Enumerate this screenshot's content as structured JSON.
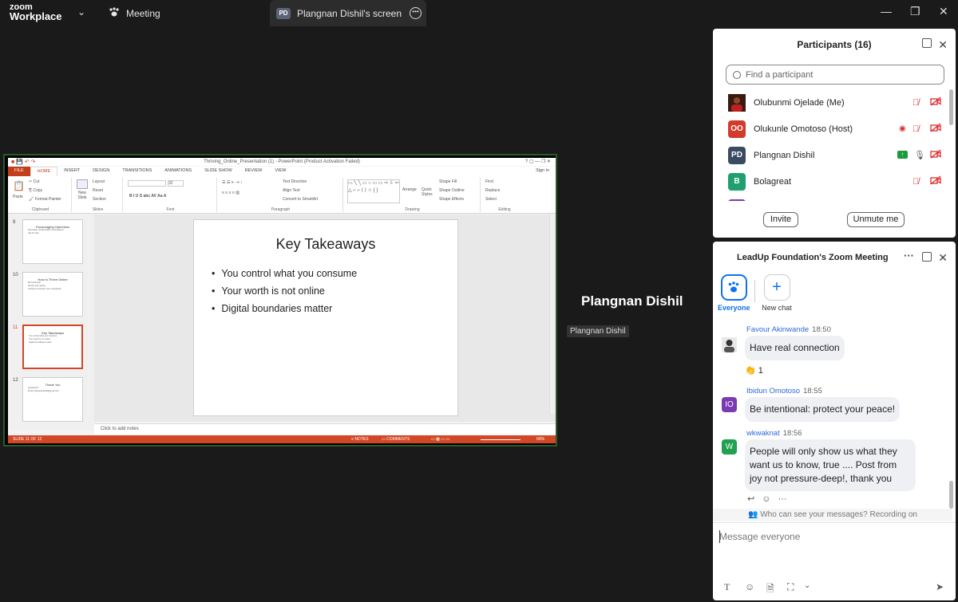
{
  "titlebar": {
    "logo_line1": "zoom",
    "logo_line2": "Workplace",
    "meeting_tab": "Meeting",
    "screen_tab_badge": "PD",
    "screen_tab_label": "Plangnan Dishil's screen"
  },
  "ppt": {
    "window_title": "Thriving_Online_Presentation (1) - PowerPoint (Product Activation Failed)",
    "tabs": [
      "FILE",
      "HOME",
      "INSERT",
      "DESIGN",
      "TRANSITIONS",
      "ANIMATIONS",
      "SLIDE SHOW",
      "REVIEW",
      "VIEW"
    ],
    "sign_in": "Sign in",
    "ribbon": {
      "paste": "Paste",
      "cut": "Cut",
      "copy": "Copy",
      "format_painter": "Format Painter",
      "clipboard": "Clipboard",
      "new_slide": "New Slide",
      "layout": "Layout",
      "reset": "Reset",
      "section": "Section",
      "slides": "Slides",
      "font_size": "32",
      "font": "Font",
      "text_direction": "Text Direction",
      "align_text": "Align Text",
      "convert_smartart": "Convert to SmartArt",
      "paragraph": "Paragraph",
      "arrange": "Arrange",
      "quick_styles": "Quick Styles",
      "shape_fill": "Shape Fill",
      "shape_outline": "Shape Outline",
      "shape_effects": "Shape Effects",
      "drawing": "Drawing",
      "find": "Find",
      "replace": "Replace",
      "select": "Select",
      "editing": "Editing"
    },
    "thumbnails": [
      {
        "num": "9",
        "title": "Encouraging Openness",
        "lines": [
          "Normalise mental health conversations",
          "Ask for help"
        ]
      },
      {
        "num": "10",
        "title": "How to Thrive Online",
        "lines": [
          "Be intentional",
          "Protect your peace",
          "Choose connection over comparison"
        ]
      },
      {
        "num": "11",
        "title": "Key Takeaways",
        "lines": [
          "You control what you consume",
          "Your worth is not online",
          "Digital boundaries matter"
        ]
      },
      {
        "num": "12",
        "title": "Thank You",
        "lines": [
          "Questions?",
          "Email: plangnandishil@gmail.com"
        ]
      }
    ],
    "slide": {
      "title": "Key Takeaways",
      "bullets": [
        "You control what you consume",
        "Your worth is not online",
        "Digital boundaries matter"
      ]
    },
    "notes_placeholder": "Click to add notes",
    "status_slide": "SLIDE 11 OF 12",
    "status_notes": "NOTES",
    "status_comments": "COMMENTS",
    "status_zoom": "69%"
  },
  "presenter": {
    "name_large": "Plangnan Dishil",
    "name_label": "Plangnan Dishil"
  },
  "participants": {
    "title": "Participants (16)",
    "search_placeholder": "Find a participant",
    "people": [
      {
        "initials": "",
        "name": "Olubunmi Ojelade (Me)",
        "color": "#7a2a1a"
      },
      {
        "initials": "OO",
        "name": "Olukunle Omotoso (Host)",
        "color": "#d23b2b"
      },
      {
        "initials": "PD",
        "name": "Plangnan Dishil",
        "color": "#3b4a63"
      },
      {
        "initials": "B",
        "name": "Bolagreat",
        "color": "#20a070"
      }
    ],
    "invite_label": "Invite",
    "unmute_label": "Unmute me"
  },
  "chat": {
    "title": "LeadUp Foundation's Zoom Meeting",
    "everyone_label": "Everyone",
    "new_chat_label": "New chat",
    "messages": [
      {
        "sender": "Favour Akinwande",
        "time": "18:50",
        "text": "Have real connection",
        "reaction": "1"
      },
      {
        "sender": "Ibidun Omotoso",
        "time": "18:55",
        "initials": "IO",
        "text": "Be intentional: protect your peace!"
      },
      {
        "sender": "wkwaknat",
        "time": "18:56",
        "initials": "W",
        "text_lines": [
          "People will only show us what they",
          "want us to know, true .... Post from",
          "joy not pressure-deep!, thank you"
        ]
      }
    ],
    "privacy_note": "Who can see your messages? Recording on",
    "composer_placeholder": "Message everyone"
  },
  "colors": {
    "ppt_accent": "#d24726",
    "zoom_blue": "#0e72ed",
    "mute_red": "#e02828"
  }
}
